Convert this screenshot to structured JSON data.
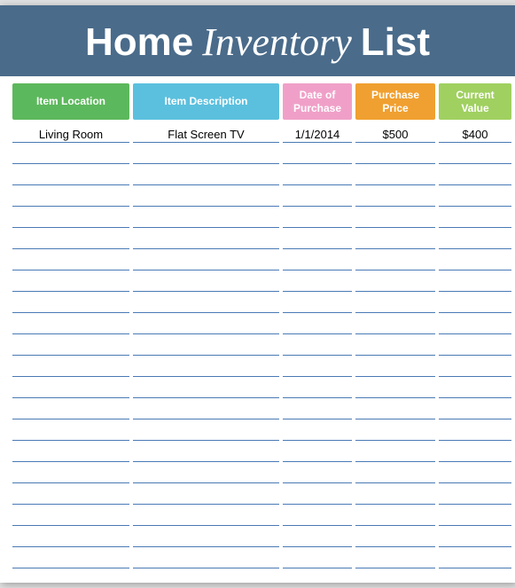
{
  "header": {
    "title_home": "Home",
    "title_inventory": "Inventory",
    "title_list": "List"
  },
  "columns": [
    {
      "id": "location",
      "label": "Item Location",
      "class": "col-header-location"
    },
    {
      "id": "description",
      "label": "Item Description",
      "class": "col-header-description"
    },
    {
      "id": "date",
      "label": "Date of Purchase",
      "class": "col-header-date"
    },
    {
      "id": "price",
      "label": "Purchase Price",
      "class": "col-header-price"
    },
    {
      "id": "value",
      "label": "Current Value",
      "class": "col-header-value"
    }
  ],
  "rows": [
    {
      "location": "Living Room",
      "description": "Flat Screen TV",
      "date": "1/1/2014",
      "price": "$500",
      "value": "$400"
    },
    {
      "location": "",
      "description": "",
      "date": "",
      "price": "",
      "value": ""
    },
    {
      "location": "",
      "description": "",
      "date": "",
      "price": "",
      "value": ""
    },
    {
      "location": "",
      "description": "",
      "date": "",
      "price": "",
      "value": ""
    },
    {
      "location": "",
      "description": "",
      "date": "",
      "price": "",
      "value": ""
    },
    {
      "location": "",
      "description": "",
      "date": "",
      "price": "",
      "value": ""
    },
    {
      "location": "",
      "description": "",
      "date": "",
      "price": "",
      "value": ""
    },
    {
      "location": "",
      "description": "",
      "date": "",
      "price": "",
      "value": ""
    },
    {
      "location": "",
      "description": "",
      "date": "",
      "price": "",
      "value": ""
    },
    {
      "location": "",
      "description": "",
      "date": "",
      "price": "",
      "value": ""
    },
    {
      "location": "",
      "description": "",
      "date": "",
      "price": "",
      "value": ""
    },
    {
      "location": "",
      "description": "",
      "date": "",
      "price": "",
      "value": ""
    },
    {
      "location": "",
      "description": "",
      "date": "",
      "price": "",
      "value": ""
    },
    {
      "location": "",
      "description": "",
      "date": "",
      "price": "",
      "value": ""
    },
    {
      "location": "",
      "description": "",
      "date": "",
      "price": "",
      "value": ""
    },
    {
      "location": "",
      "description": "",
      "date": "",
      "price": "",
      "value": ""
    },
    {
      "location": "",
      "description": "",
      "date": "",
      "price": "",
      "value": ""
    },
    {
      "location": "",
      "description": "",
      "date": "",
      "price": "",
      "value": ""
    },
    {
      "location": "",
      "description": "",
      "date": "",
      "price": "",
      "value": ""
    },
    {
      "location": "",
      "description": "",
      "date": "",
      "price": "",
      "value": ""
    },
    {
      "location": "",
      "description": "",
      "date": "",
      "price": "",
      "value": ""
    }
  ]
}
